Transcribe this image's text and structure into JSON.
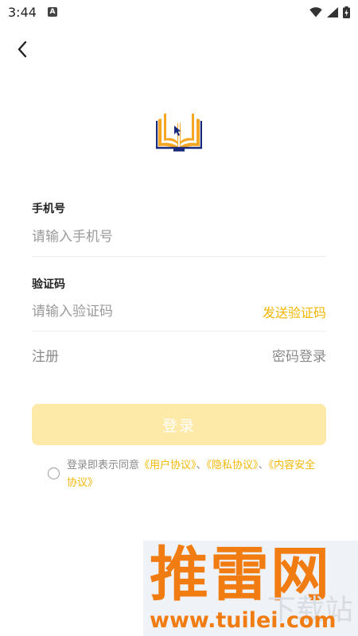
{
  "status_bar": {
    "time": "3:44",
    "notification_badge": "A"
  },
  "logo": {
    "icon": "open-book-with-cursor-icon"
  },
  "form": {
    "phone": {
      "label": "手机号",
      "placeholder": "请输入手机号"
    },
    "code": {
      "label": "验证码",
      "placeholder": "请输入验证码",
      "send_code": "发送验证码"
    }
  },
  "links": {
    "register": "注册",
    "password_login": "密码登录"
  },
  "login_button": {
    "label": "登录"
  },
  "agreement": {
    "prefix": "登录即表示同意",
    "user_agreement": "《用户协议》",
    "sep1": "、",
    "privacy_agreement": "《隐私协议》",
    "sep2": "、",
    "content_safety_agreement": "《内容安全协议》"
  },
  "watermark": {
    "brand": "推雷网",
    "sub": "下载站",
    "url": "www.tuilei.com"
  },
  "colors": {
    "accent": "#f2b705",
    "button_disabled": "#fde9a8",
    "logo_orange": "#f5a623",
    "logo_blue": "#1a2a7a",
    "watermark_orange": "#f07c12"
  }
}
